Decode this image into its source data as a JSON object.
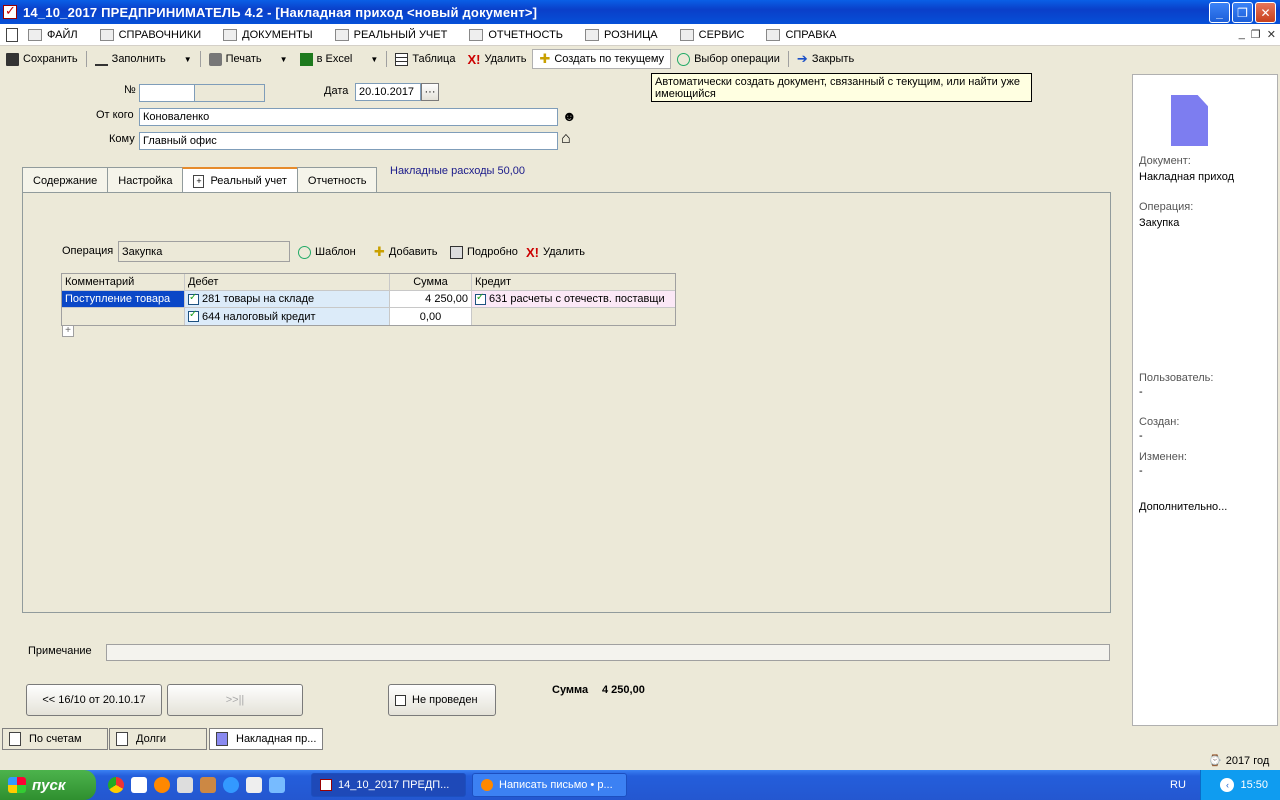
{
  "window": {
    "title": "14_10_2017  ПРЕДПРИНИМАТЕЛЬ 4.2 - [Накладная приход <новый документ>]"
  },
  "menu": {
    "items": [
      "ФАЙЛ",
      "СПРАВОЧНИКИ",
      "ДОКУМЕНТЫ",
      "РЕАЛЬНЫЙ УЧЕТ",
      "ОТЧЕТНОСТЬ",
      "РОЗНИЦА",
      "СЕРВИС",
      "СПРАВКА"
    ]
  },
  "toolbar": {
    "save": "Сохранить",
    "fill": "Заполнить",
    "print": "Печать",
    "excel": "в Excel",
    "table": "Таблица",
    "delete": "Удалить",
    "create_from_current": "Создать по текущему",
    "choose_operation": "Выбор операции",
    "close": "Закрыть"
  },
  "tooltip": {
    "text": "Автоматически создать документ, связанный с текущим, или найти уже имеющийся"
  },
  "form": {
    "number_label": "№",
    "number_value": "",
    "date_label": "Дата",
    "date_value": "20.10.2017",
    "from_label": "От кого",
    "from_value": "Коноваленко",
    "to_label": "Кому",
    "to_value": "Главный офис",
    "overhead": "Накладные расходы 50,00"
  },
  "tabs": [
    "Содержание",
    "Настройка",
    "Реальный учет",
    "Отчетность"
  ],
  "panel": {
    "operation_label": "Операция",
    "operation_value": "Закупка",
    "template": "Шаблон",
    "add": "Добавить",
    "details": "Подробно",
    "delete": "Удалить"
  },
  "grid": {
    "headers": [
      "Комментарий",
      "Дебет",
      "Сумма",
      "Кредит"
    ],
    "rows": [
      {
        "comment": "Поступление товара",
        "debit": "281 товары на складе",
        "sum": "4 250,00",
        "credit": "631  расчеты с  отечеств. поставщи"
      },
      {
        "comment": "",
        "debit": "644 налоговый кредит",
        "sum": "0,00",
        "credit": ""
      }
    ]
  },
  "sidebar": {
    "doc_label": "Документ:",
    "doc_value": "Накладная приход",
    "op_label": "Операция:",
    "op_value": "Закупка",
    "user_label": "Пользователь:",
    "user_value": "-",
    "created_label": "Создан:",
    "created_value": "-",
    "changed_label": "Изменен:",
    "changed_value": "-",
    "more": "Дополнительно..."
  },
  "footer": {
    "note_label": "Примечание",
    "note_value": "",
    "prev_btn": "<< 16/10 от 20.10.17",
    "next_btn": ">>||",
    "posted": "Не проведен",
    "sum_label": "Сумма",
    "sum_value": "4 250,00"
  },
  "bottom_tabs": [
    "По счетам",
    "Долги",
    "Накладная пр..."
  ],
  "status": {
    "year": "2017 год"
  },
  "taskbar": {
    "start": "пуск",
    "tasks": [
      "14_10_2017  ПРЕДП...",
      "Написать письмо • р..."
    ],
    "lang": "RU",
    "clock": "15:50"
  }
}
